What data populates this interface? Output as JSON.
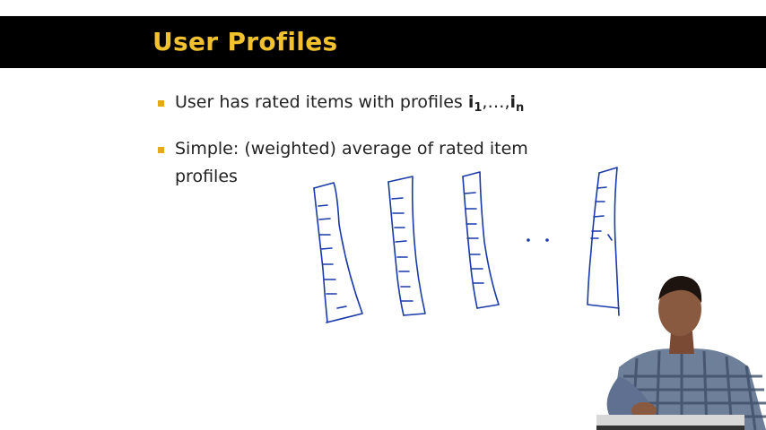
{
  "slide": {
    "title": "User Profiles",
    "bullets": [
      {
        "text": "User has rated items with profiles ",
        "math": {
          "base1": "i",
          "sub1": "1",
          "sep": ",…,",
          "base2": "i",
          "sub2": "n"
        }
      },
      {
        "line1": "Simple: (weighted) average of rated item",
        "line2": "profiles"
      }
    ]
  },
  "colors": {
    "title_bar": "#000000",
    "title_text": "#f2c12e",
    "bullet": "#e6a817",
    "ink": "#1a3aa8"
  },
  "drawing": {
    "vectors": 4,
    "ellipsis": "· ·"
  }
}
